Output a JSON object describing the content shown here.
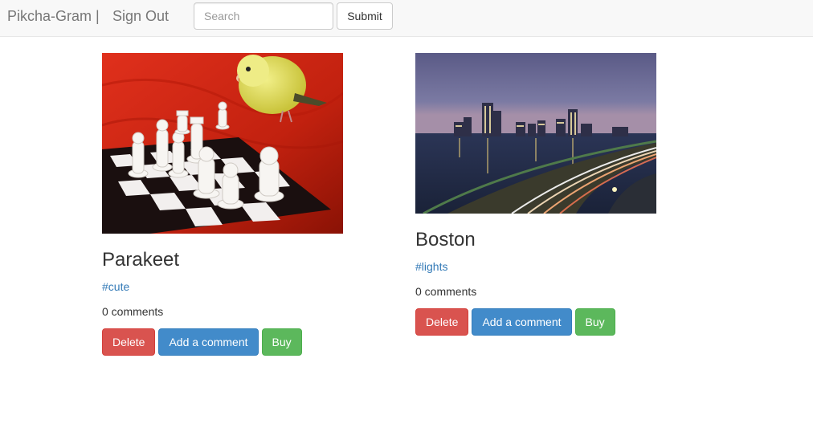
{
  "navbar": {
    "brand": "Pikcha-Gram |",
    "signout": "Sign Out",
    "search_placeholder": "Search",
    "submit_label": "Submit"
  },
  "posts": [
    {
      "title": "Parakeet",
      "tag": "#cute",
      "comments": "0 comments",
      "image_subject": "parakeet-and-chess-photo",
      "delete_label": "Delete",
      "comment_label": "Add a comment",
      "buy_label": "Buy"
    },
    {
      "title": "Boston",
      "tag": "#lights",
      "comments": "0 comments",
      "image_subject": "boston-skyline-night-photo",
      "delete_label": "Delete",
      "comment_label": "Add a comment",
      "buy_label": "Buy"
    }
  ],
  "colors": {
    "danger": "#d9534f",
    "primary": "#428bca",
    "success": "#5cb85c",
    "link": "#337ab7"
  }
}
